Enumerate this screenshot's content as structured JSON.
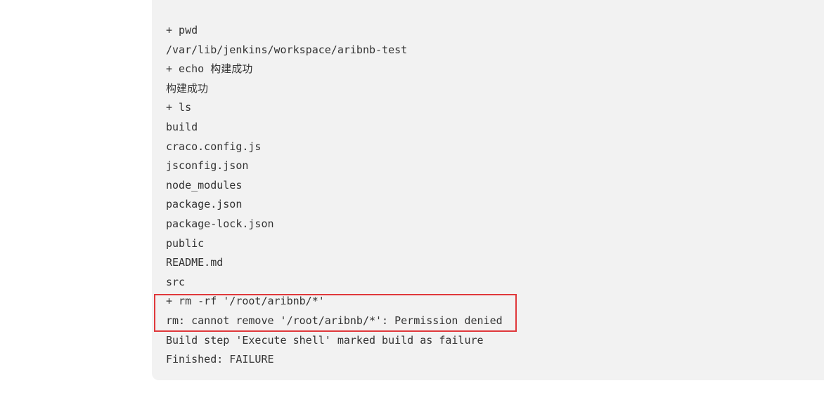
{
  "console": {
    "lines": [
      "+ pwd",
      "/var/lib/jenkins/workspace/aribnb-test",
      "+ echo 构建成功",
      "构建成功",
      "+ ls",
      "build",
      "craco.config.js",
      "jsconfig.json",
      "node_modules",
      "package.json",
      "package-lock.json",
      "public",
      "README.md",
      "src",
      "+ rm -rf '/root/aribnb/*'",
      "rm: cannot remove '/root/aribnb/*': Permission denied",
      "Build step 'Execute shell' marked build as failure",
      "Finished: FAILURE"
    ]
  },
  "colors": {
    "panel_background": "#f2f2f2",
    "text": "#333333",
    "highlight_border": "#e0383b"
  }
}
